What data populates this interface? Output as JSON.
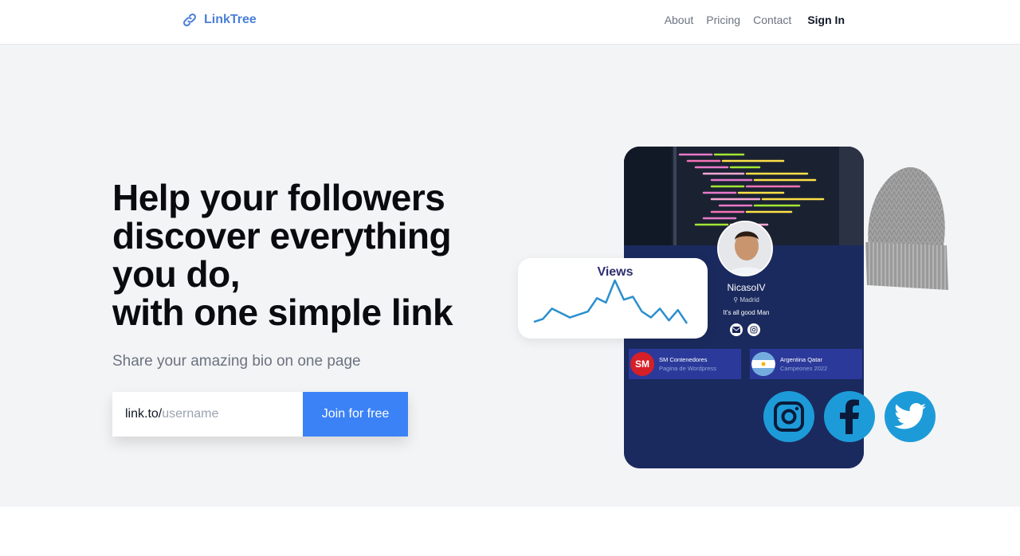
{
  "header": {
    "brand": "LinkTree",
    "nav": {
      "about": "About",
      "pricing": "Pricing",
      "contact": "Contact",
      "signin": "Sign In"
    }
  },
  "hero": {
    "headline_lines": [
      "Help your followers",
      "discover everything",
      "you do,",
      "with one simple link"
    ],
    "subtitle": "Share your amazing bio on one page",
    "signup": {
      "prefix": "link.to/",
      "placeholder": "username",
      "button": "Join for free"
    }
  },
  "illustration": {
    "views_card": {
      "title": "Views",
      "series": [
        14,
        18,
        32,
        26,
        20,
        24,
        28,
        46,
        40,
        70,
        44,
        48,
        28,
        20,
        32,
        16,
        30,
        12
      ],
      "line_color": "#2b8fcf"
    },
    "profile": {
      "name": "NicasoIV",
      "location": "Madrid",
      "bio": "It's all good Man"
    },
    "links": [
      {
        "title": "SM Contenedores",
        "subtitle": "Pagina de Wordpress",
        "logo_text": "SM",
        "logo_color": "#d61f26"
      },
      {
        "title": "Argentina Qatar",
        "subtitle": "Campeones 2022",
        "logo_text": "",
        "logo_color": "#74acdf"
      }
    ],
    "socials": [
      "instagram-icon",
      "facebook-icon",
      "twitter-icon"
    ]
  },
  "colors": {
    "brand": "#4a7fd6",
    "button": "#3b82f6",
    "hero_bg": "#f3f4f6",
    "phone_bg": "#172554",
    "social": "#1d9bd8"
  }
}
